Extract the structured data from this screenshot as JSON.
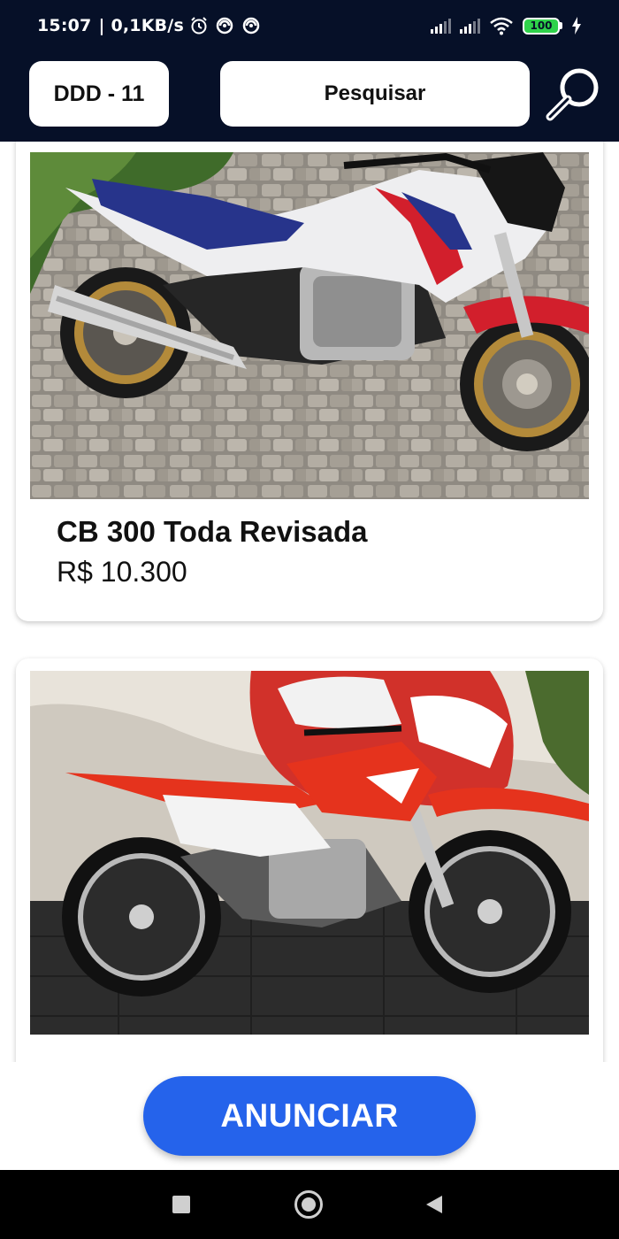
{
  "status_bar": {
    "time": "15:07",
    "network_speed": "| 0,1KB/s",
    "battery": "100",
    "icons": [
      "alarm-icon",
      "sync-icon",
      "sync-icon",
      "signal-icon",
      "signal-icon",
      "wifi-icon",
      "battery-icon",
      "charging-icon"
    ]
  },
  "header": {
    "ddd_label": "DDD - 11",
    "search_label": "Pesquisar",
    "search_icon": "magnifier-icon",
    "background": "#061028"
  },
  "listings": [
    {
      "title": "CB 300 Toda Revisada",
      "price": "R$ 10.300"
    },
    {
      "title": "",
      "price": ""
    }
  ],
  "cta": {
    "label": "ANUNCIAR",
    "color": "#2563eb"
  },
  "nav": {
    "icons": [
      "recents-square-icon",
      "home-circle-icon",
      "back-triangle-icon"
    ]
  }
}
